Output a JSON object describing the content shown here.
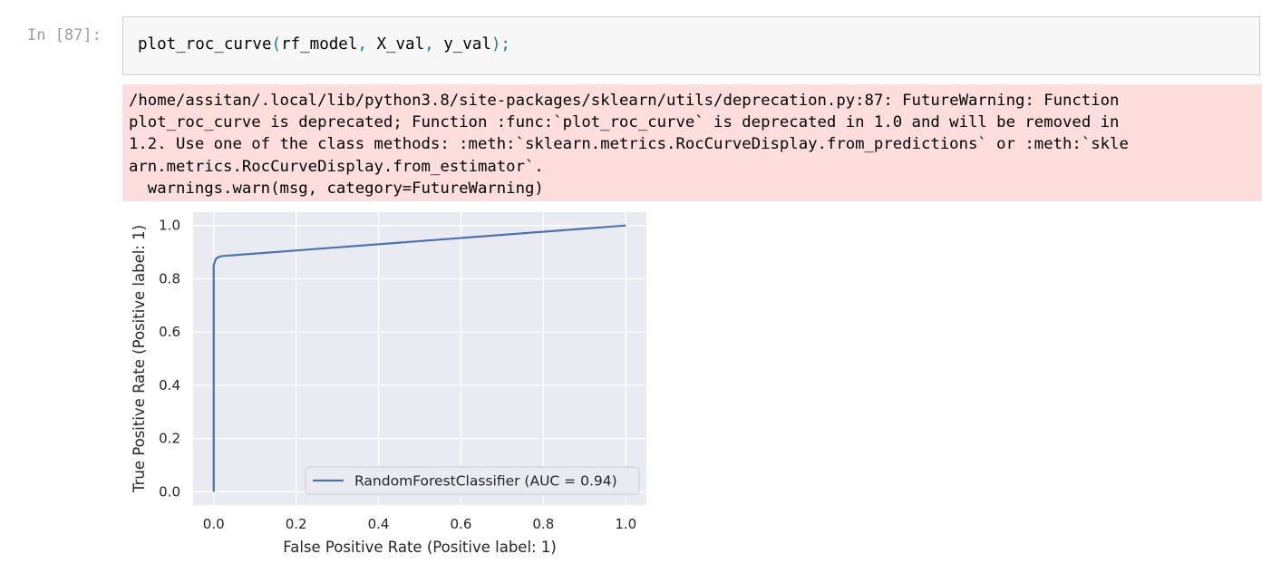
{
  "cell": {
    "prompt": "In [87]:",
    "code": {
      "func": "plot_roc_curve",
      "open_paren": "(",
      "arg1": "rf_model",
      "comma1": ", ",
      "arg2": "X_val",
      "comma2": ", ",
      "arg3": "y_val",
      "close": ");"
    }
  },
  "output": {
    "stderr_lines": [
      "/home/assitan/.local/lib/python3.8/site-packages/sklearn/utils/deprecation.py:87: FutureWarning: Function",
      "plot_roc_curve is deprecated; Function :func:`plot_roc_curve` is deprecated in 1.0 and will be removed in",
      "1.2. Use one of the class methods: :meth:`sklearn.metrics.RocCurveDisplay.from_predictions` or :meth:`skle",
      "arn.metrics.RocCurveDisplay.from_estimator`.",
      "  warnings.warn(msg, category=FutureWarning)"
    ]
  },
  "chart_data": {
    "type": "line",
    "title": "",
    "xlabel": "False Positive Rate (Positive label: 1)",
    "ylabel": "True Positive Rate (Positive label: 1)",
    "xlim": [
      -0.05,
      1.05
    ],
    "ylim": [
      -0.05,
      1.05
    ],
    "xticks": [
      "0.0",
      "0.2",
      "0.4",
      "0.6",
      "0.8",
      "1.0"
    ],
    "yticks": [
      "0.0",
      "0.2",
      "0.4",
      "0.6",
      "0.8",
      "1.0"
    ],
    "grid": true,
    "legend_position": "lower right",
    "background": "#eaeaf2",
    "series": [
      {
        "name": "RandomForestClassifier (AUC = 0.94)",
        "color": "#4c72b0",
        "x": [
          0.0,
          0.0,
          0.002,
          0.004,
          0.006,
          0.01,
          0.02,
          1.0
        ],
        "y": [
          0.0,
          0.85,
          0.86,
          0.87,
          0.875,
          0.88,
          0.885,
          1.0
        ]
      }
    ]
  }
}
